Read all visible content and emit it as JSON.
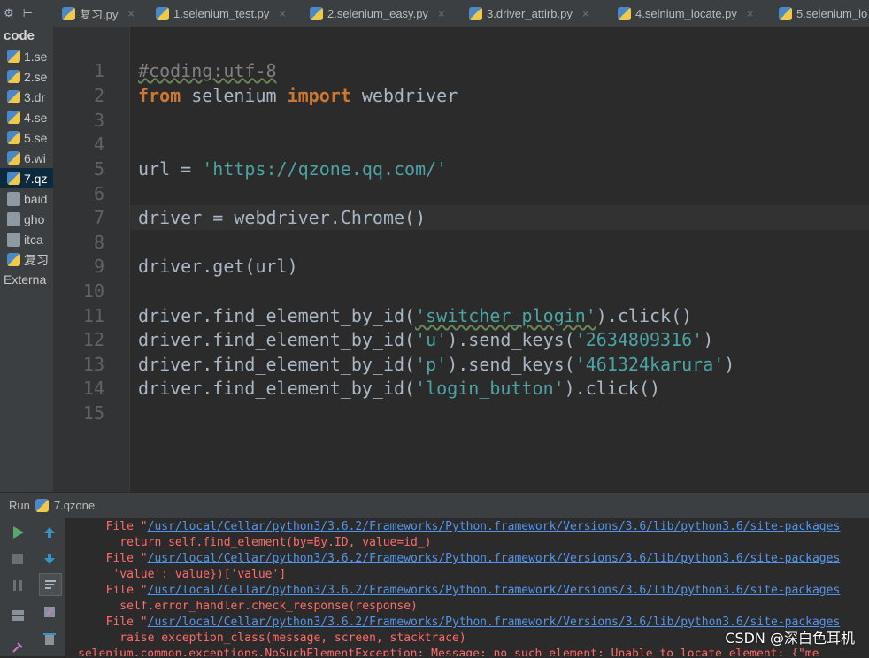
{
  "tabbar": {
    "tabs": [
      {
        "label": "复习.py"
      },
      {
        "label": "1.selenium_test.py"
      },
      {
        "label": "2.selenium_easy.py"
      },
      {
        "label": "3.driver_attirb.py"
      },
      {
        "label": "4.selnium_locate.py"
      },
      {
        "label": "5.selenium_lo"
      }
    ],
    "close_glyph": "×"
  },
  "sidebar": {
    "title": "code",
    "items": [
      {
        "label": "1.se",
        "icon": "python-file-icon"
      },
      {
        "label": "2.se",
        "icon": "python-file-icon"
      },
      {
        "label": "3.dr",
        "icon": "python-file-icon"
      },
      {
        "label": "4.se",
        "icon": "python-file-icon"
      },
      {
        "label": "5.se",
        "icon": "python-file-icon"
      },
      {
        "label": "6.wi",
        "icon": "python-file-icon"
      },
      {
        "label": "7.qz",
        "icon": "python-file-icon",
        "selected": true
      },
      {
        "label": "baid",
        "icon": "text-file-icon"
      },
      {
        "label": "gho",
        "icon": "text-file-icon"
      },
      {
        "label": "itca",
        "icon": "text-file-icon"
      },
      {
        "label": "复习",
        "icon": "python-file-icon"
      }
    ],
    "external": "Externa"
  },
  "editor": {
    "line_numbers": [
      "1",
      "2",
      "3",
      "4",
      "5",
      "6",
      "7",
      "8",
      "9",
      "10",
      "11",
      "12",
      "13",
      "14",
      "15"
    ],
    "current_line": "7",
    "lines": {
      "l1": "#coding:utf-8",
      "l2_kw1": "from",
      "l2_a": " selenium ",
      "l2_kw2": "import",
      "l2_b": " webdriver",
      "l5_a": "url = ",
      "l5_str": "'https://qzone.qq.com/'",
      "l7": "driver = webdriver.Chrome()",
      "l9": "driver.get(url)",
      "l11_a": "driver.find_element_by_id(",
      "l11_str": "'switcher_plogin'",
      "l11_b": ").click()",
      "l12_a": "driver.find_element_by_id(",
      "l12_str1": "'u'",
      "l12_b": ").send_keys(",
      "l12_str2": "'2634809316'",
      "l12_c": ")",
      "l13_a": "driver.find_element_by_id(",
      "l13_str1": "'p'",
      "l13_b": ").send_keys(",
      "l13_str2": "'461324karura'",
      "l13_c": ")",
      "l14_a": "driver.find_element_by_id(",
      "l14_str": "'login_button'",
      "l14_b": ").click()"
    }
  },
  "run": {
    "label": "Run",
    "config": "7.qzone",
    "console": {
      "file_prefix": "  File \"",
      "path": "/usr/local/Cellar/python3/3.6.2/Frameworks/Python.framework/Versions/3.6/lib/python3.6/site-packages",
      "line2": "    return self.find_element(by=By.ID, value=id_)",
      "line4": "   'value': value})['value']",
      "line6": "    self.error_handler.check_response(response)",
      "line8": "    raise exception_class(message, screen, stacktrace)",
      "line9": "selenium.common.exceptions.NoSuchElementException: Message: no such element: Unable to locate element: {\"me"
    }
  },
  "watermark": "CSDN @深白色耳机"
}
